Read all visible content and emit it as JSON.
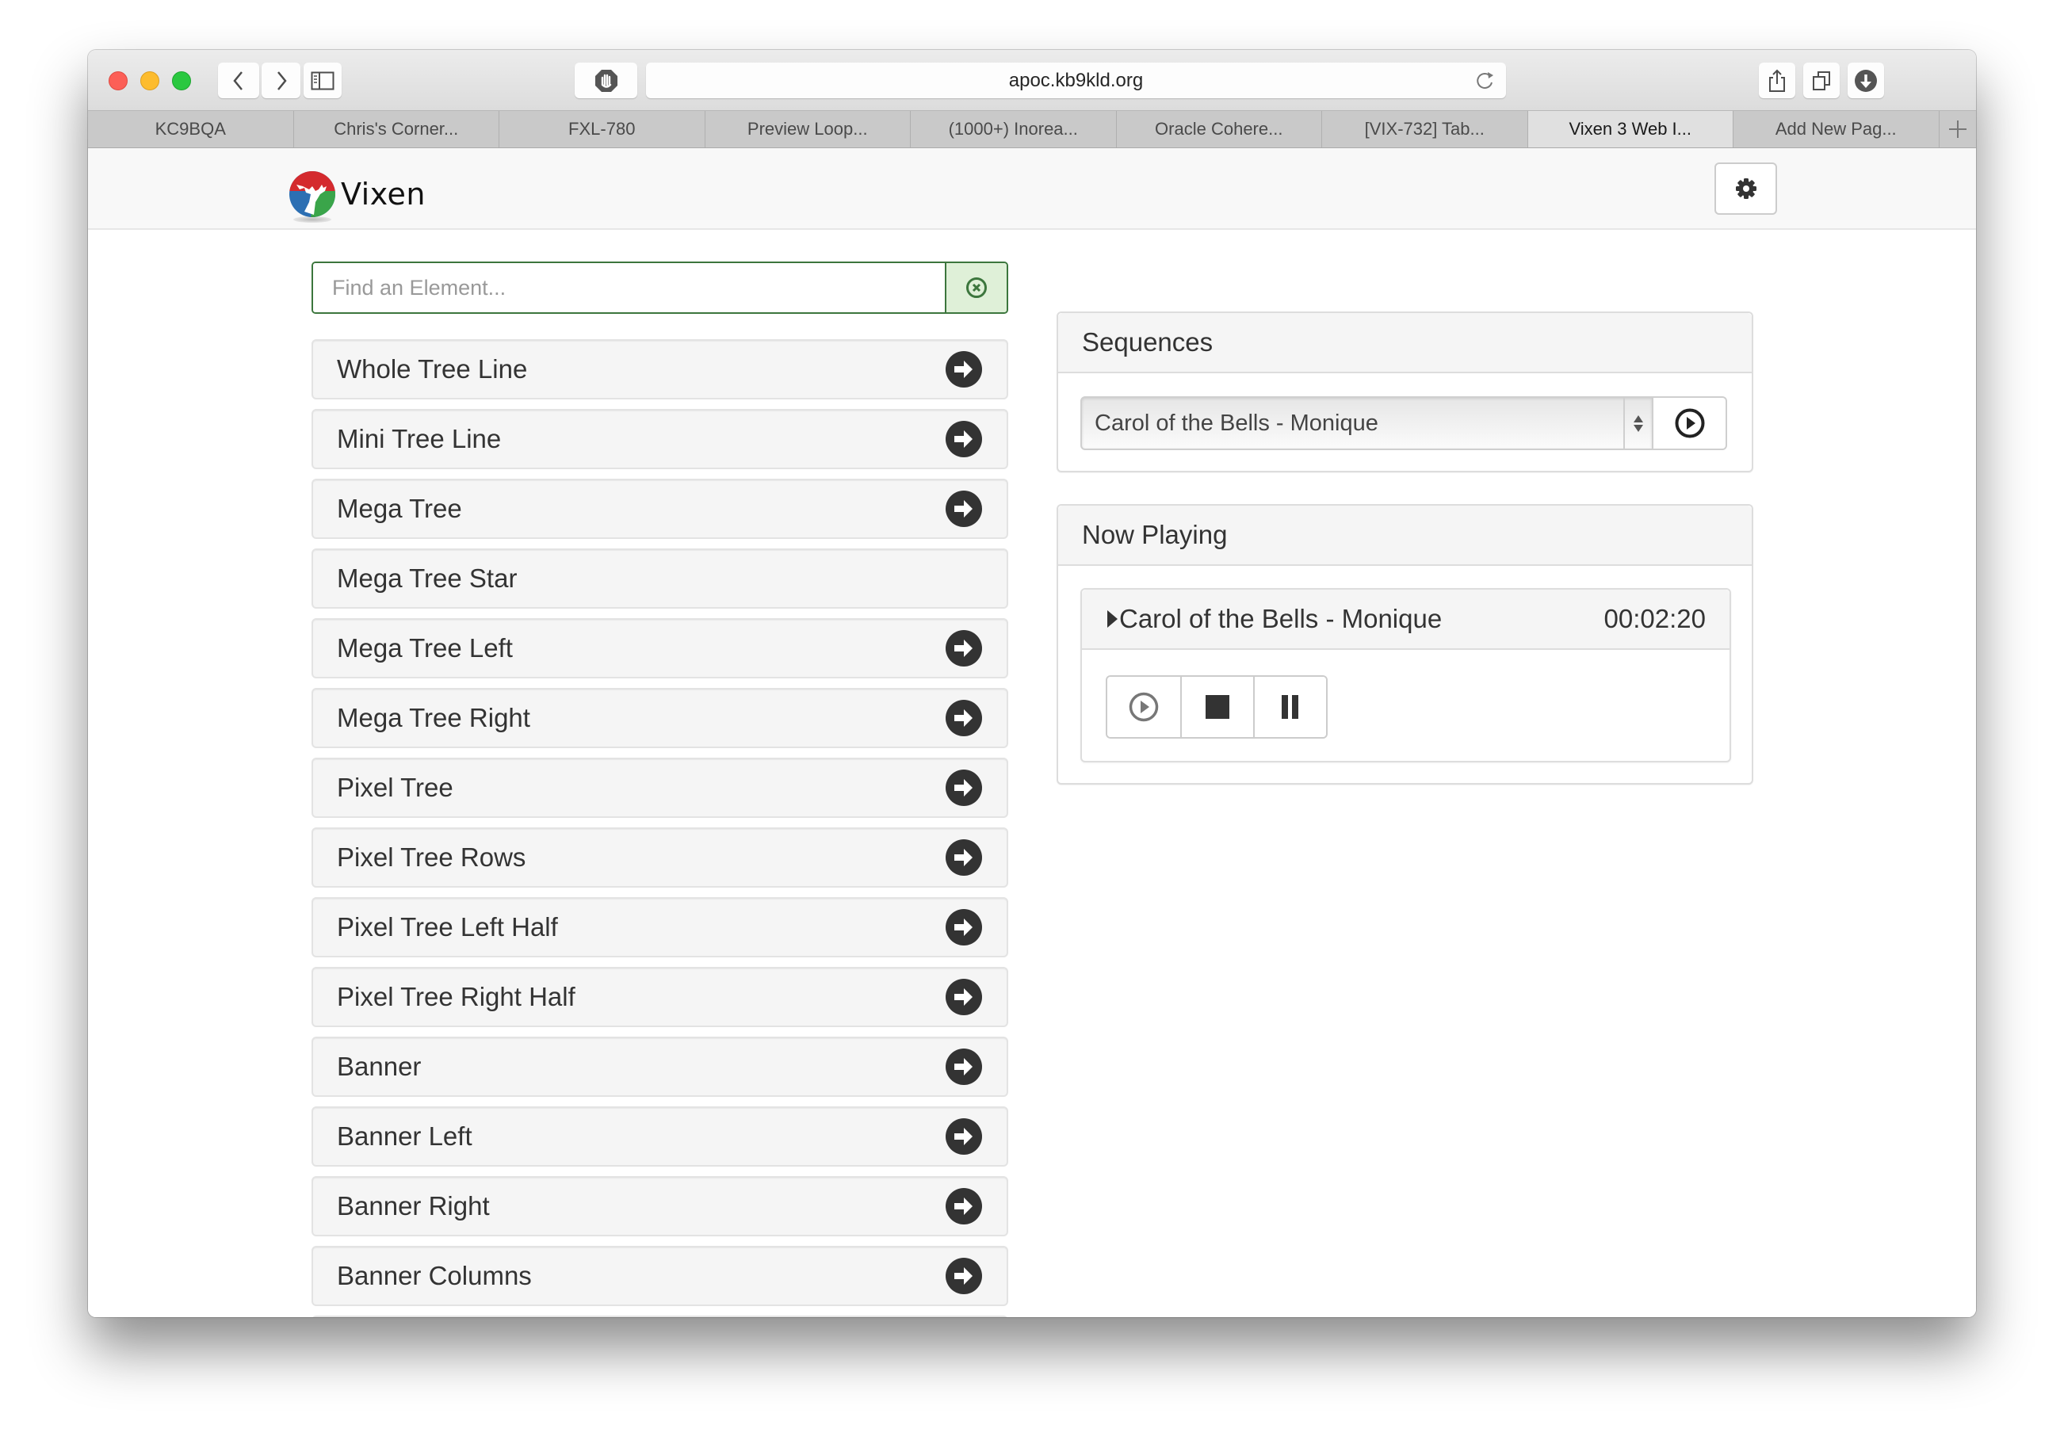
{
  "browser": {
    "url": "apoc.kb9kld.org",
    "tabs": [
      {
        "label": "KC9BQA",
        "active": false
      },
      {
        "label": "Chris's Corner...",
        "active": false
      },
      {
        "label": "FXL-780",
        "active": false
      },
      {
        "label": "Preview Loop...",
        "active": false
      },
      {
        "label": "(1000+) Inorea...",
        "active": false
      },
      {
        "label": "Oracle Cohere...",
        "active": false
      },
      {
        "label": "[VIX-732] Tab...",
        "active": false
      },
      {
        "label": "Vixen 3 Web I...",
        "active": true
      },
      {
        "label": "Add New Pag...",
        "active": false
      }
    ],
    "icons": {
      "back": "chevron-left-icon",
      "forward": "chevron-right-icon",
      "sidebar": "sidebar-icon",
      "extension": "stop-hand-icon",
      "reload": "reload-icon",
      "share": "share-icon",
      "tabs": "tabs-overview-icon",
      "downloads": "download-icon",
      "new_tab": "plus-icon"
    }
  },
  "app": {
    "brand": "Vixen",
    "colors": {
      "success_border": "#3c763d",
      "success_bg": "#dff0d8",
      "text": "#333333",
      "panel_heading_bg": "#f5f5f5"
    }
  },
  "search": {
    "placeholder": "Find an Element...",
    "value": ""
  },
  "elements": [
    {
      "label": "Whole Tree Line",
      "has_children": true
    },
    {
      "label": "Mini Tree Line",
      "has_children": true
    },
    {
      "label": "Mega Tree",
      "has_children": true
    },
    {
      "label": "Mega Tree Star",
      "has_children": false
    },
    {
      "label": "Mega Tree Left",
      "has_children": true
    },
    {
      "label": "Mega Tree Right",
      "has_children": true
    },
    {
      "label": "Pixel Tree",
      "has_children": true
    },
    {
      "label": "Pixel Tree Rows",
      "has_children": true
    },
    {
      "label": "Pixel Tree Left Half",
      "has_children": true
    },
    {
      "label": "Pixel Tree Right Half",
      "has_children": true
    },
    {
      "label": "Banner",
      "has_children": true
    },
    {
      "label": "Banner Left",
      "has_children": true
    },
    {
      "label": "Banner Right",
      "has_children": true
    },
    {
      "label": "Banner Columns",
      "has_children": true
    }
  ],
  "sequences": {
    "heading": "Sequences",
    "selected": "Carol of the Bells - Monique"
  },
  "now_playing": {
    "heading": "Now Playing",
    "title": "Carol of the Bells - Monique",
    "time": "00:02:20",
    "controls": [
      "play",
      "stop",
      "pause"
    ]
  }
}
